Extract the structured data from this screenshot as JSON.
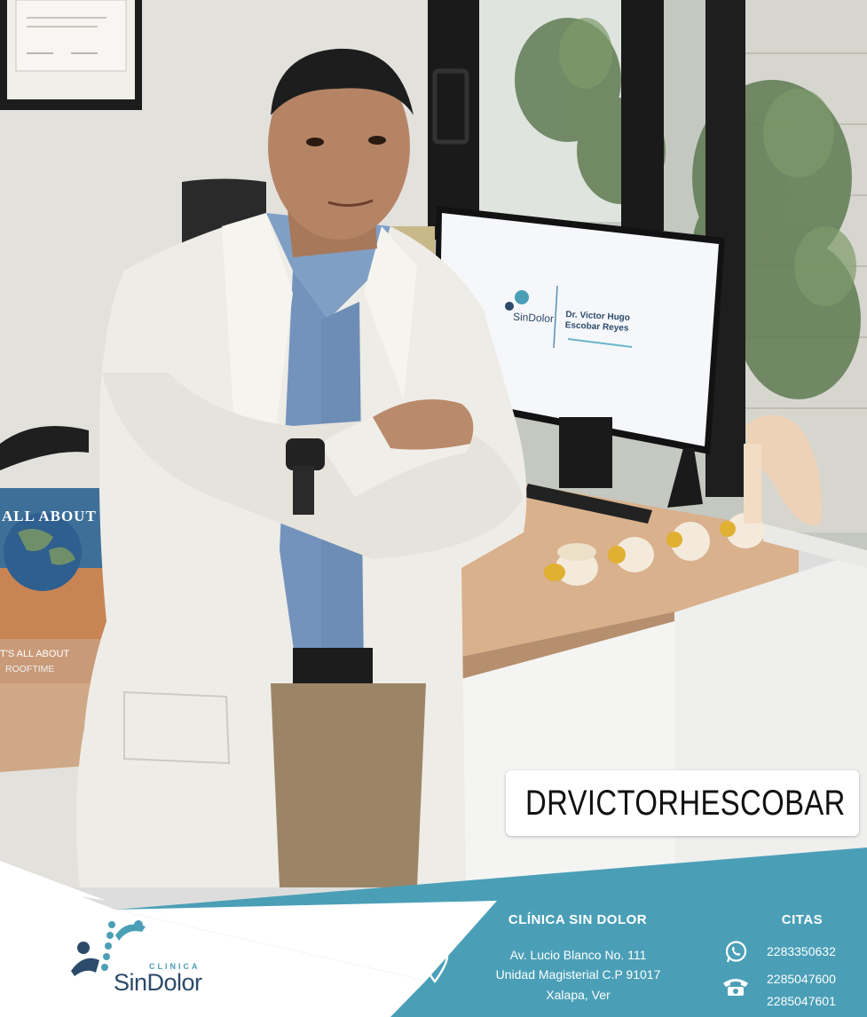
{
  "instagram": {
    "handle": "DRVICTORHESCOBAR",
    "icon": "instagram-icon"
  },
  "poster": {
    "headline": "ALL ABOUT",
    "caption_line1": "T'S ALL ABOUT",
    "caption_line2": "ROOFTIME"
  },
  "monitor": {
    "logo_text": "SinDolor",
    "name_line1": "Dr. Victor Hugo",
    "name_line2": "Escobar Reyes"
  },
  "footer": {
    "logo": {
      "small_label": "CLINICA",
      "brand": "SinDolor"
    },
    "clinic": {
      "title": "CLÍNICA SIN DOLOR",
      "address_line1": "Av. Lucio Blanco No. 111",
      "address_line2": "Unidad Magisterial C.P 91017",
      "address_line3": "Xalapa, Ver"
    },
    "citas": {
      "title": "CITAS",
      "whatsapp": "2283350632",
      "phone1": "2285047600",
      "phone2": "2285047601"
    },
    "colors": {
      "teal": "#4a9fb7",
      "navy": "#2c4a6a",
      "white": "#ffffff"
    }
  }
}
